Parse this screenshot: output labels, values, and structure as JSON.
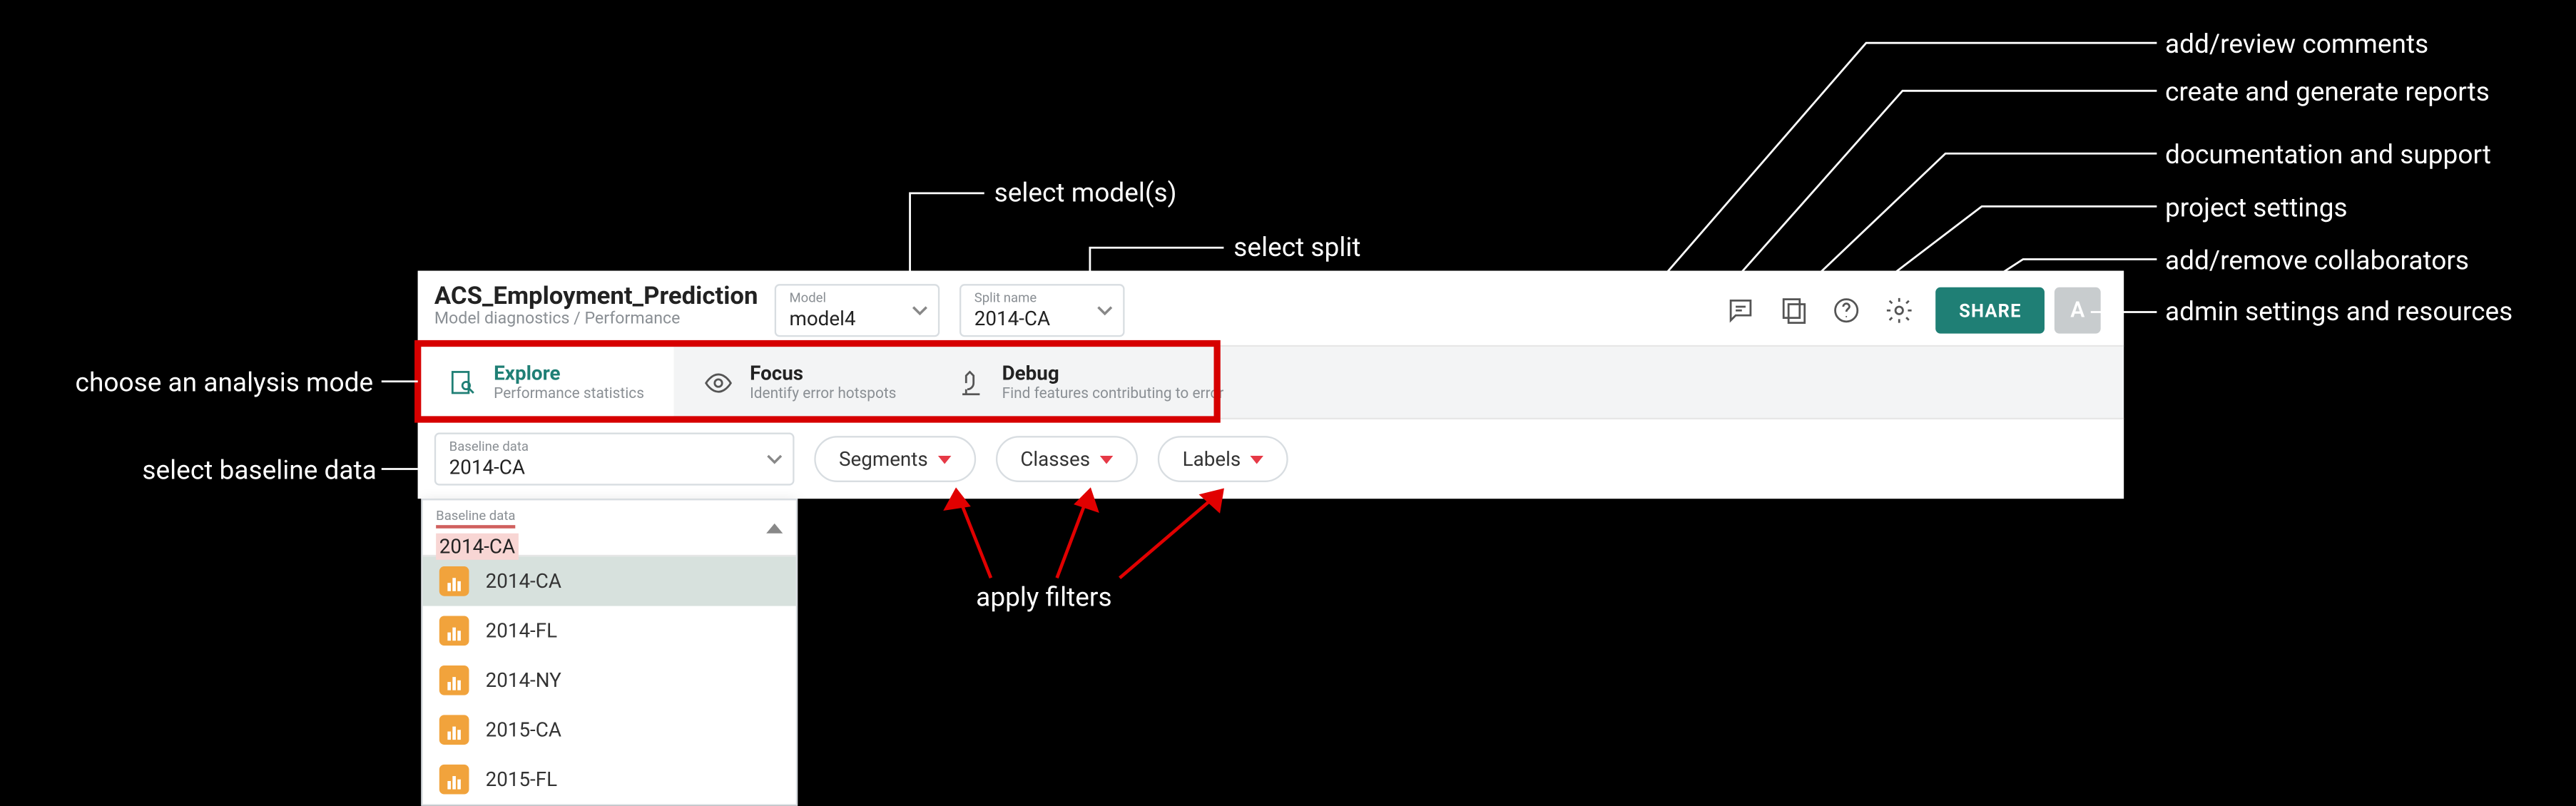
{
  "header": {
    "title": "ACS_Employment_Prediction",
    "breadcrumb": "Model diagnostics / Performance",
    "model": {
      "label": "Model",
      "value": "model4"
    },
    "split": {
      "label": "Split name",
      "value": "2014-CA"
    },
    "share_label": "SHARE",
    "avatar_initial": "A"
  },
  "modes": [
    {
      "title": "Explore",
      "subtitle": "Performance statistics"
    },
    {
      "title": "Focus",
      "subtitle": "Identify error hotspots"
    },
    {
      "title": "Debug",
      "subtitle": "Find features contributing to error"
    }
  ],
  "filters": {
    "baseline": {
      "label": "Baseline data",
      "value": "2014-CA"
    },
    "segments_label": "Segments",
    "classes_label": "Classes",
    "labels_label": "Labels"
  },
  "dropdown": {
    "label": "Baseline data",
    "value": "2014-CA",
    "options": [
      "2014-CA",
      "2014-FL",
      "2014-NY",
      "2015-CA",
      "2015-FL"
    ]
  },
  "annotations": {
    "choose_mode": "choose an analysis mode",
    "select_baseline": "select baseline data",
    "select_models": "select model(s)",
    "select_split": "select split",
    "apply_filters": "apply filters",
    "comments": "add/review comments",
    "reports": "create and generate reports",
    "docs": "documentation and support",
    "settings": "project settings",
    "collaborators": "add/remove collaborators",
    "admin": "admin settings and resources"
  }
}
